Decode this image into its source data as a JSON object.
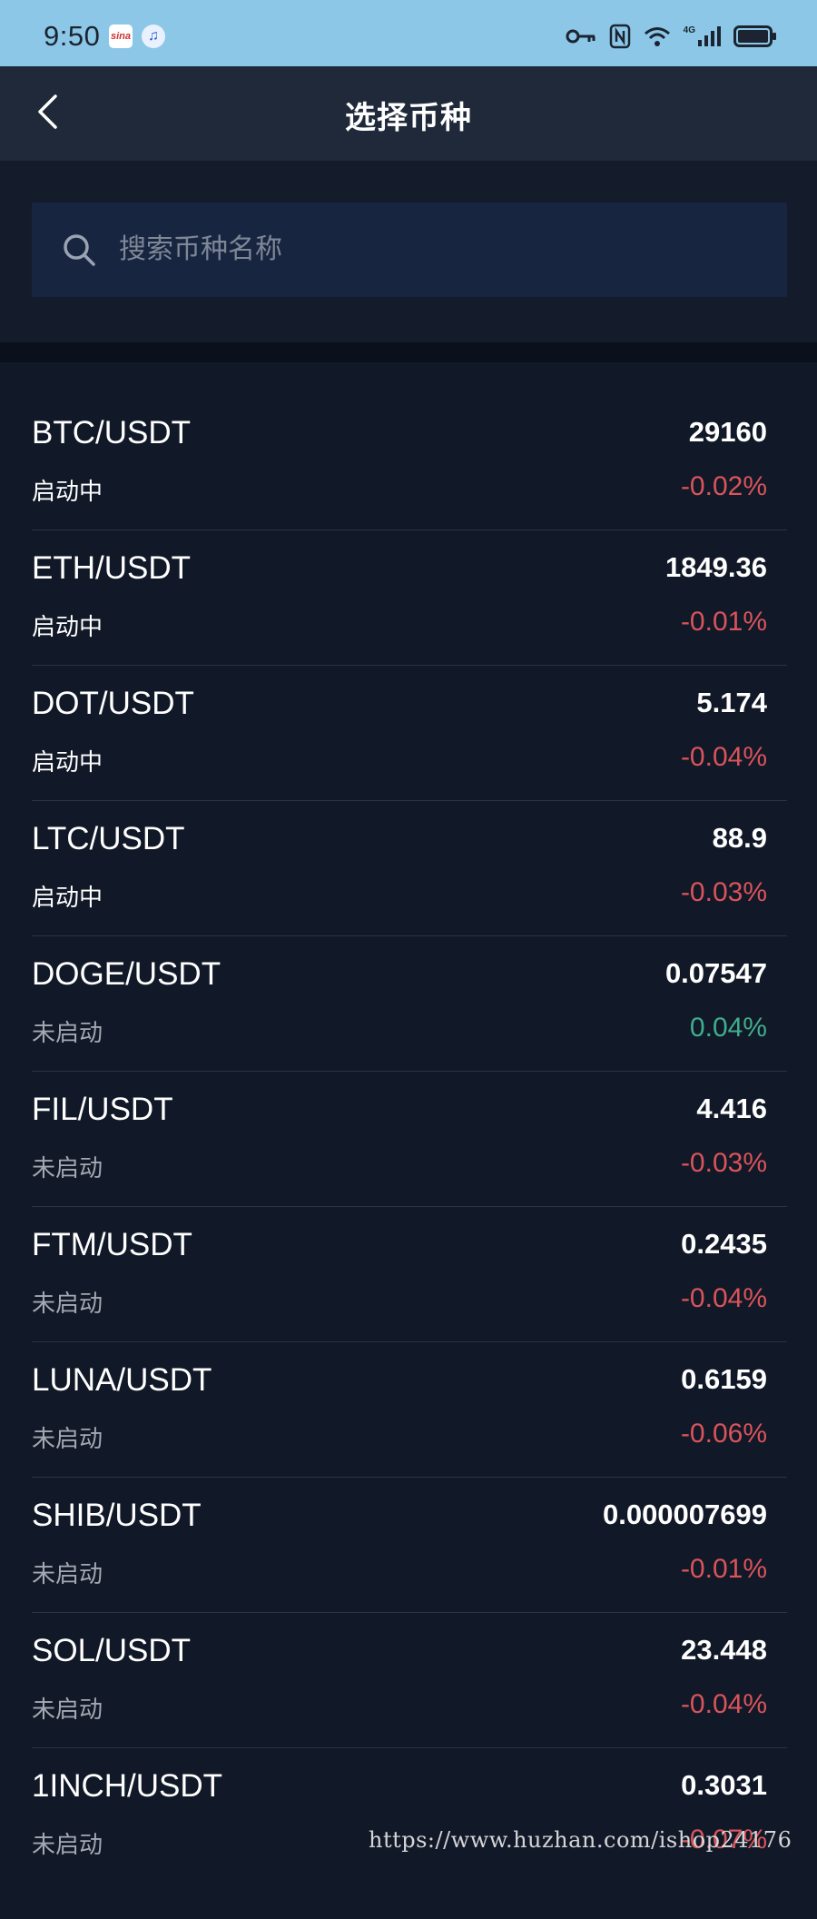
{
  "status_bar": {
    "time": "9:50",
    "icons": [
      "weibo-app-icon",
      "music-app-icon",
      "key-icon",
      "nfc-icon",
      "wifi-icon",
      "4g-signal-icon",
      "battery-icon"
    ],
    "weibo_label": "sina",
    "music_symbol": "♫",
    "network_label": "4G",
    "colors": {
      "background": "#8cc7e8",
      "foreground": "#1b2430"
    }
  },
  "nav": {
    "title": "选择币种",
    "back_icon": "chevron-left-icon"
  },
  "search": {
    "placeholder": "搜索币种名称",
    "value": "",
    "icon": "search-icon"
  },
  "coins": [
    {
      "pair": "BTC/USDT",
      "status": "启动中",
      "price": "29160",
      "change": "-0.02%",
      "direction": "down"
    },
    {
      "pair": "ETH/USDT",
      "status": "启动中",
      "price": "1849.36",
      "change": "-0.01%",
      "direction": "down"
    },
    {
      "pair": "DOT/USDT",
      "status": "启动中",
      "price": "5.174",
      "change": "-0.04%",
      "direction": "down"
    },
    {
      "pair": "LTC/USDT",
      "status": "启动中",
      "price": "88.9",
      "change": "-0.03%",
      "direction": "down"
    },
    {
      "pair": "DOGE/USDT",
      "status": "未启动",
      "price": "0.07547",
      "change": "0.04%",
      "direction": "up"
    },
    {
      "pair": "FIL/USDT",
      "status": "未启动",
      "price": "4.416",
      "change": "-0.03%",
      "direction": "down"
    },
    {
      "pair": "FTM/USDT",
      "status": "未启动",
      "price": "0.2435",
      "change": "-0.04%",
      "direction": "down"
    },
    {
      "pair": "LUNA/USDT",
      "status": "未启动",
      "price": "0.6159",
      "change": "-0.06%",
      "direction": "down"
    },
    {
      "pair": "SHIB/USDT",
      "status": "未启动",
      "price": "0.000007699",
      "change": "-0.01%",
      "direction": "down"
    },
    {
      "pair": "SOL/USDT",
      "status": "未启动",
      "price": "23.448",
      "change": "-0.04%",
      "direction": "down"
    },
    {
      "pair": "1INCH/USDT",
      "status": "未启动",
      "price": "0.3031",
      "change": "-0.07%",
      "direction": "down"
    }
  ],
  "watermark": "https://www.huzhan.com/ishop24176",
  "colors": {
    "page_background": "#111827",
    "nav_background": "#1f2939",
    "search_background": "#172541",
    "negative_change": "#d9545b",
    "positive_change": "#3fae8c",
    "active_status_text": "#ffffff",
    "inactive_status_text": "#a3a9b3"
  }
}
